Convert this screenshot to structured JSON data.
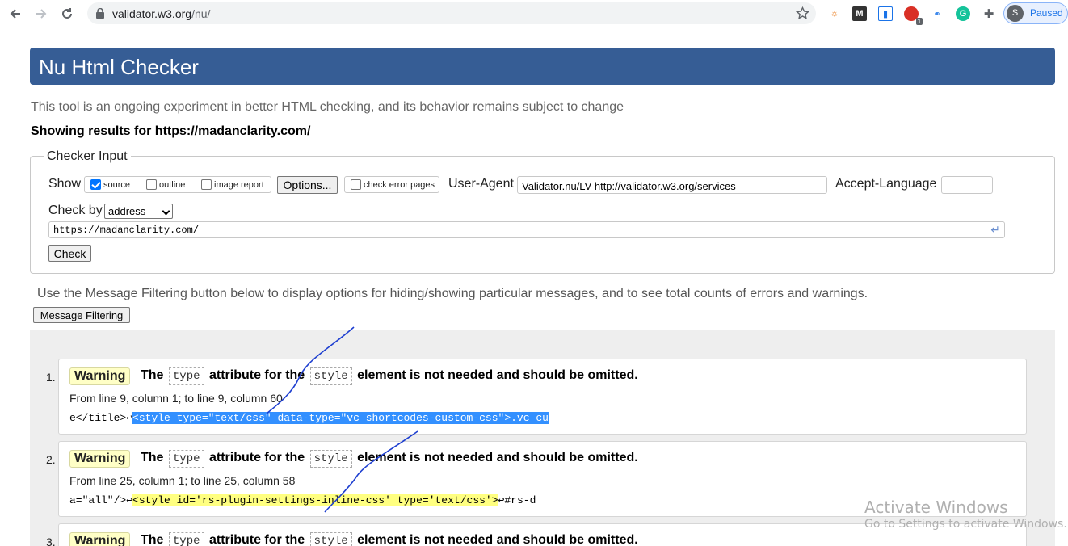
{
  "browser": {
    "url_host": "validator.w3.org",
    "url_path": "/nu/",
    "profile_initial": "S",
    "profile_status": "Paused",
    "extension_badge": "1"
  },
  "page": {
    "title": "Nu Html Checker",
    "tagline": "This tool is an ongoing experiment in better HTML checking, and its behavior remains subject to change",
    "showing_results": "Showing results for https://madanclarity.com/"
  },
  "checker_input": {
    "legend": "Checker Input",
    "show_label": "Show",
    "options": [
      {
        "label": "source",
        "checked": true
      },
      {
        "label": "outline",
        "checked": false
      },
      {
        "label": "image report",
        "checked": false
      }
    ],
    "options_button": "Options...",
    "check_error_pages": {
      "label": "check error pages",
      "checked": false
    },
    "user_agent_label": "User-Agent",
    "user_agent_value": "Validator.nu/LV http://validator.w3.org/services",
    "accept_language_label": "Accept-Language",
    "accept_language_value": "",
    "check_by_label": "Check by",
    "check_by_value": "address",
    "address_value": "https://madanclarity.com/",
    "check_button": "Check"
  },
  "filtering": {
    "note": "Use the Message Filtering button below to display options for hiding/showing particular messages, and to see total counts of errors and warnings.",
    "button": "Message Filtering"
  },
  "messages": [
    {
      "number": "1.",
      "type": "Warning",
      "text_a": "The",
      "code_a": "type",
      "text_b": "attribute for the",
      "code_b": "style",
      "text_c": "element is not needed and should be omitted.",
      "location": "From line 9, column 1; to line 9, column 60",
      "extract_pre": "e</title>↩",
      "extract_hl": "<style type=\"text/css\" data-type=\"vc_shortcodes-custom-css\">",
      "extract_post": ".vc_cu"
    },
    {
      "number": "2.",
      "type": "Warning",
      "text_a": "The",
      "code_a": "type",
      "text_b": "attribute for the",
      "code_b": "style",
      "text_c": "element is not needed and should be omitted.",
      "location": "From line 25, column 1; to line 25, column 58",
      "extract_pre": "a=\"all\"/>↩",
      "extract_hl": "<style id='rs-plugin-settings-inline-css' type='text/css'>",
      "extract_post": "↩#rs-d"
    },
    {
      "number": "3.",
      "type": "Warning",
      "text_a": "The",
      "code_a": "type",
      "text_b": "attribute for the",
      "code_b": "style",
      "text_c": "element is not needed and should be omitted."
    }
  ],
  "watermark": {
    "line1": "Activate Windows",
    "line2": "Go to Settings to activate Windows."
  },
  "colors": {
    "banner": "#365d95",
    "warning_bg": "#ffffc6",
    "extract_highlight": "#ffff80",
    "selection": "#3390ff",
    "ink": "#1e3fd0"
  }
}
